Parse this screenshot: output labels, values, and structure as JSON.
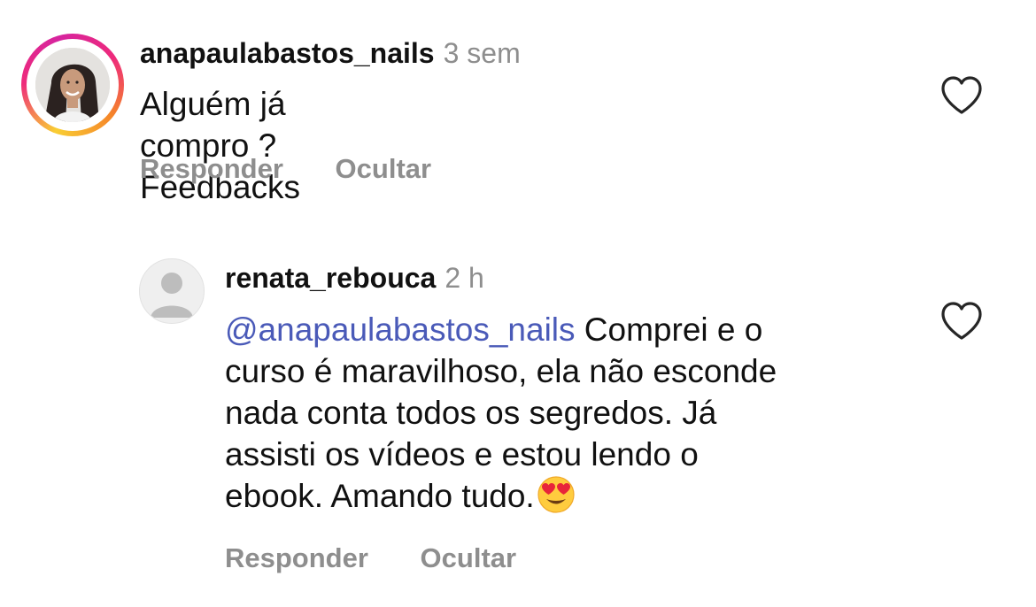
{
  "comments": [
    {
      "username": "anapaulabastos_nails",
      "time": "3 sem",
      "text": "Alguém já compro ? Feedbacks",
      "actions": {
        "reply": "Responder",
        "hide": "Ocultar"
      },
      "avatar": "profile-photo-with-story-ring",
      "like_icon": "heart-outline-icon"
    },
    {
      "username": "renata_rebouca",
      "time": "2 h",
      "mention": "@anapaulabastos_nails",
      "text_lines": [
        "Comprei e o",
        "curso é maravilhoso, ela não esconde",
        "nada conta todos os segredos. Já",
        "assisti os vídeos e estou lendo o",
        "ebook. Amando tudo."
      ],
      "emoji": "heart-eyes-emoji",
      "actions": {
        "reply": "Responder",
        "hide": "Ocultar"
      },
      "avatar": "default-avatar",
      "like_icon": "heart-outline-icon"
    }
  ],
  "colors": {
    "text": "#111111",
    "secondary": "#8e8e8e",
    "mention": "#4a5ab8",
    "ring_start": "#f9ce34",
    "ring_mid": "#ee2a7b",
    "ring_end": "#d6249f"
  }
}
